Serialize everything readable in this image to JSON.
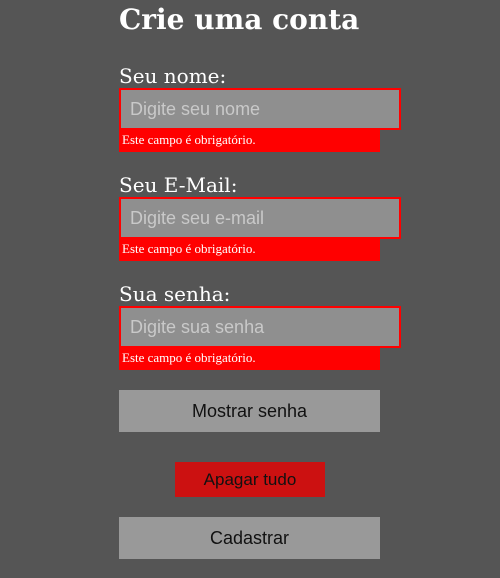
{
  "form": {
    "title": "Crie uma conta",
    "fields": [
      {
        "label": "Seu nome:",
        "placeholder": "Digite seu nome",
        "value": "",
        "error": "Este campo é obrigatório."
      },
      {
        "label": "Seu E-Mail:",
        "placeholder": "Digite seu e-mail",
        "value": "",
        "error": "Este campo é obrigatório."
      },
      {
        "label": "Sua senha:",
        "placeholder": "Digite sua senha",
        "value": "",
        "error": "Este campo é obrigatório."
      }
    ],
    "buttons": {
      "show_password": "Mostrar senha",
      "clear_all": "Apagar tudo",
      "submit": "Cadastrar"
    }
  },
  "colors": {
    "background": "#555555",
    "input_background": "#8f8f8f",
    "error": "#ff0000",
    "clear_button": "#cc1111",
    "gray_button": "#999999"
  }
}
